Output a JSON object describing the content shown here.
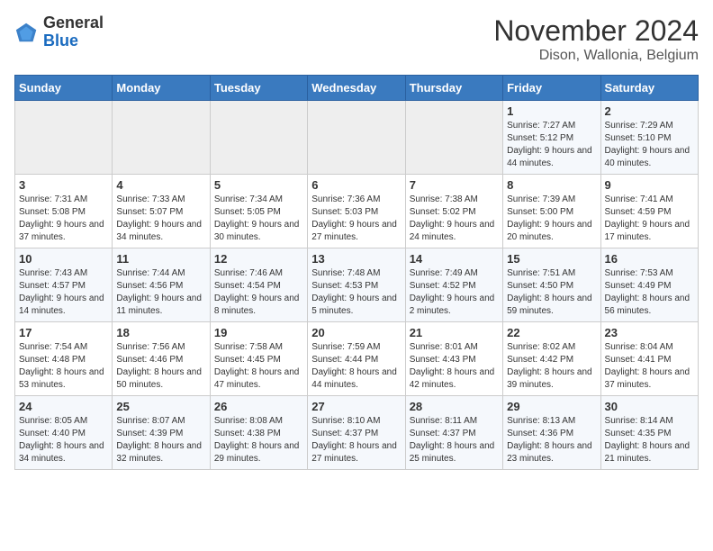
{
  "header": {
    "logo_general": "General",
    "logo_blue": "Blue",
    "month_title": "November 2024",
    "location": "Dison, Wallonia, Belgium"
  },
  "columns": [
    "Sunday",
    "Monday",
    "Tuesday",
    "Wednesday",
    "Thursday",
    "Friday",
    "Saturday"
  ],
  "weeks": [
    [
      {
        "day": "",
        "detail": ""
      },
      {
        "day": "",
        "detail": ""
      },
      {
        "day": "",
        "detail": ""
      },
      {
        "day": "",
        "detail": ""
      },
      {
        "day": "",
        "detail": ""
      },
      {
        "day": "1",
        "detail": "Sunrise: 7:27 AM\nSunset: 5:12 PM\nDaylight: 9 hours and 44 minutes."
      },
      {
        "day": "2",
        "detail": "Sunrise: 7:29 AM\nSunset: 5:10 PM\nDaylight: 9 hours and 40 minutes."
      }
    ],
    [
      {
        "day": "3",
        "detail": "Sunrise: 7:31 AM\nSunset: 5:08 PM\nDaylight: 9 hours and 37 minutes."
      },
      {
        "day": "4",
        "detail": "Sunrise: 7:33 AM\nSunset: 5:07 PM\nDaylight: 9 hours and 34 minutes."
      },
      {
        "day": "5",
        "detail": "Sunrise: 7:34 AM\nSunset: 5:05 PM\nDaylight: 9 hours and 30 minutes."
      },
      {
        "day": "6",
        "detail": "Sunrise: 7:36 AM\nSunset: 5:03 PM\nDaylight: 9 hours and 27 minutes."
      },
      {
        "day": "7",
        "detail": "Sunrise: 7:38 AM\nSunset: 5:02 PM\nDaylight: 9 hours and 24 minutes."
      },
      {
        "day": "8",
        "detail": "Sunrise: 7:39 AM\nSunset: 5:00 PM\nDaylight: 9 hours and 20 minutes."
      },
      {
        "day": "9",
        "detail": "Sunrise: 7:41 AM\nSunset: 4:59 PM\nDaylight: 9 hours and 17 minutes."
      }
    ],
    [
      {
        "day": "10",
        "detail": "Sunrise: 7:43 AM\nSunset: 4:57 PM\nDaylight: 9 hours and 14 minutes."
      },
      {
        "day": "11",
        "detail": "Sunrise: 7:44 AM\nSunset: 4:56 PM\nDaylight: 9 hours and 11 minutes."
      },
      {
        "day": "12",
        "detail": "Sunrise: 7:46 AM\nSunset: 4:54 PM\nDaylight: 9 hours and 8 minutes."
      },
      {
        "day": "13",
        "detail": "Sunrise: 7:48 AM\nSunset: 4:53 PM\nDaylight: 9 hours and 5 minutes."
      },
      {
        "day": "14",
        "detail": "Sunrise: 7:49 AM\nSunset: 4:52 PM\nDaylight: 9 hours and 2 minutes."
      },
      {
        "day": "15",
        "detail": "Sunrise: 7:51 AM\nSunset: 4:50 PM\nDaylight: 8 hours and 59 minutes."
      },
      {
        "day": "16",
        "detail": "Sunrise: 7:53 AM\nSunset: 4:49 PM\nDaylight: 8 hours and 56 minutes."
      }
    ],
    [
      {
        "day": "17",
        "detail": "Sunrise: 7:54 AM\nSunset: 4:48 PM\nDaylight: 8 hours and 53 minutes."
      },
      {
        "day": "18",
        "detail": "Sunrise: 7:56 AM\nSunset: 4:46 PM\nDaylight: 8 hours and 50 minutes."
      },
      {
        "day": "19",
        "detail": "Sunrise: 7:58 AM\nSunset: 4:45 PM\nDaylight: 8 hours and 47 minutes."
      },
      {
        "day": "20",
        "detail": "Sunrise: 7:59 AM\nSunset: 4:44 PM\nDaylight: 8 hours and 44 minutes."
      },
      {
        "day": "21",
        "detail": "Sunrise: 8:01 AM\nSunset: 4:43 PM\nDaylight: 8 hours and 42 minutes."
      },
      {
        "day": "22",
        "detail": "Sunrise: 8:02 AM\nSunset: 4:42 PM\nDaylight: 8 hours and 39 minutes."
      },
      {
        "day": "23",
        "detail": "Sunrise: 8:04 AM\nSunset: 4:41 PM\nDaylight: 8 hours and 37 minutes."
      }
    ],
    [
      {
        "day": "24",
        "detail": "Sunrise: 8:05 AM\nSunset: 4:40 PM\nDaylight: 8 hours and 34 minutes."
      },
      {
        "day": "25",
        "detail": "Sunrise: 8:07 AM\nSunset: 4:39 PM\nDaylight: 8 hours and 32 minutes."
      },
      {
        "day": "26",
        "detail": "Sunrise: 8:08 AM\nSunset: 4:38 PM\nDaylight: 8 hours and 29 minutes."
      },
      {
        "day": "27",
        "detail": "Sunrise: 8:10 AM\nSunset: 4:37 PM\nDaylight: 8 hours and 27 minutes."
      },
      {
        "day": "28",
        "detail": "Sunrise: 8:11 AM\nSunset: 4:37 PM\nDaylight: 8 hours and 25 minutes."
      },
      {
        "day": "29",
        "detail": "Sunrise: 8:13 AM\nSunset: 4:36 PM\nDaylight: 8 hours and 23 minutes."
      },
      {
        "day": "30",
        "detail": "Sunrise: 8:14 AM\nSunset: 4:35 PM\nDaylight: 8 hours and 21 minutes."
      }
    ]
  ]
}
